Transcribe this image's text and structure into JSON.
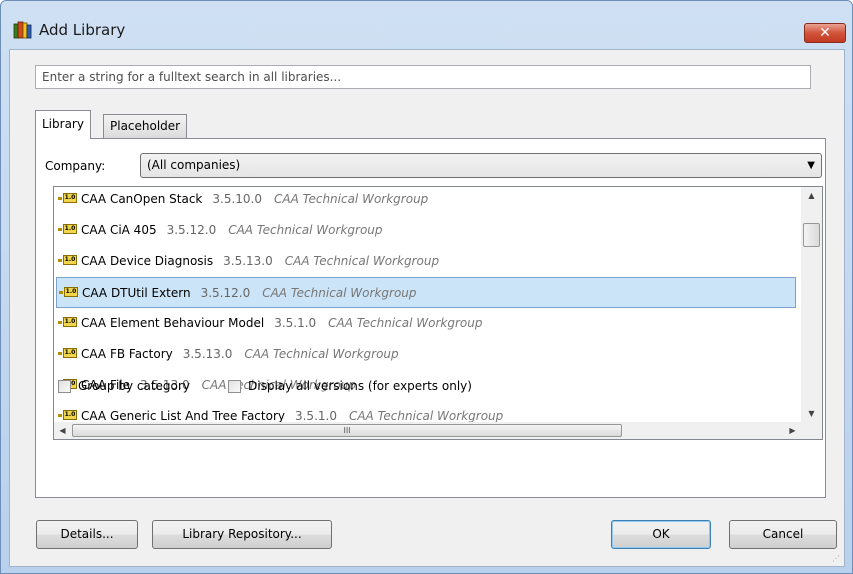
{
  "window": {
    "title": "Add Library",
    "close_label": "✕"
  },
  "search": {
    "placeholder": "Enter a string for a fulltext search in all libraries..."
  },
  "tabs": [
    {
      "label": "Library",
      "active": true
    },
    {
      "label": "Placeholder",
      "active": false
    }
  ],
  "company": {
    "label": "Company:",
    "selected": "(All companies)"
  },
  "libraries": [
    {
      "name": "CAA CanOpen Stack",
      "version": "3.5.10.0",
      "company": "CAA Technical Workgroup",
      "selected": false
    },
    {
      "name": "CAA CiA 405",
      "version": "3.5.12.0",
      "company": "CAA Technical Workgroup",
      "selected": false
    },
    {
      "name": "CAA Device Diagnosis",
      "version": "3.5.13.0",
      "company": "CAA Technical Workgroup",
      "selected": false
    },
    {
      "name": "CAA DTUtil Extern",
      "version": "3.5.12.0",
      "company": "CAA Technical Workgroup",
      "selected": true
    },
    {
      "name": "CAA Element Behaviour Model",
      "version": "3.5.1.0",
      "company": "CAA Technical Workgroup",
      "selected": false
    },
    {
      "name": "CAA FB Factory",
      "version": "3.5.13.0",
      "company": "CAA Technical Workgroup",
      "selected": false
    },
    {
      "name": "CAA File",
      "version": "3.5.13.0",
      "company": "CAA Technical Workgroup",
      "selected": false
    },
    {
      "name": "CAA Generic List And Tree Factory",
      "version": "3.5.1.0",
      "company": "CAA Technical Workgroup",
      "selected": false
    }
  ],
  "library_icon_text": "1.0",
  "options": {
    "group_by_category": "Group by category",
    "display_all_versions": "Display all versions (for experts only)"
  },
  "buttons": {
    "details": "Details...",
    "library_repository": "Library Repository...",
    "ok": "OK",
    "cancel": "Cancel"
  },
  "scrollbar": {
    "h_thumb_glyph": "III"
  },
  "colors": {
    "selection": "#cce4f7",
    "close_button": "#c94a30"
  }
}
